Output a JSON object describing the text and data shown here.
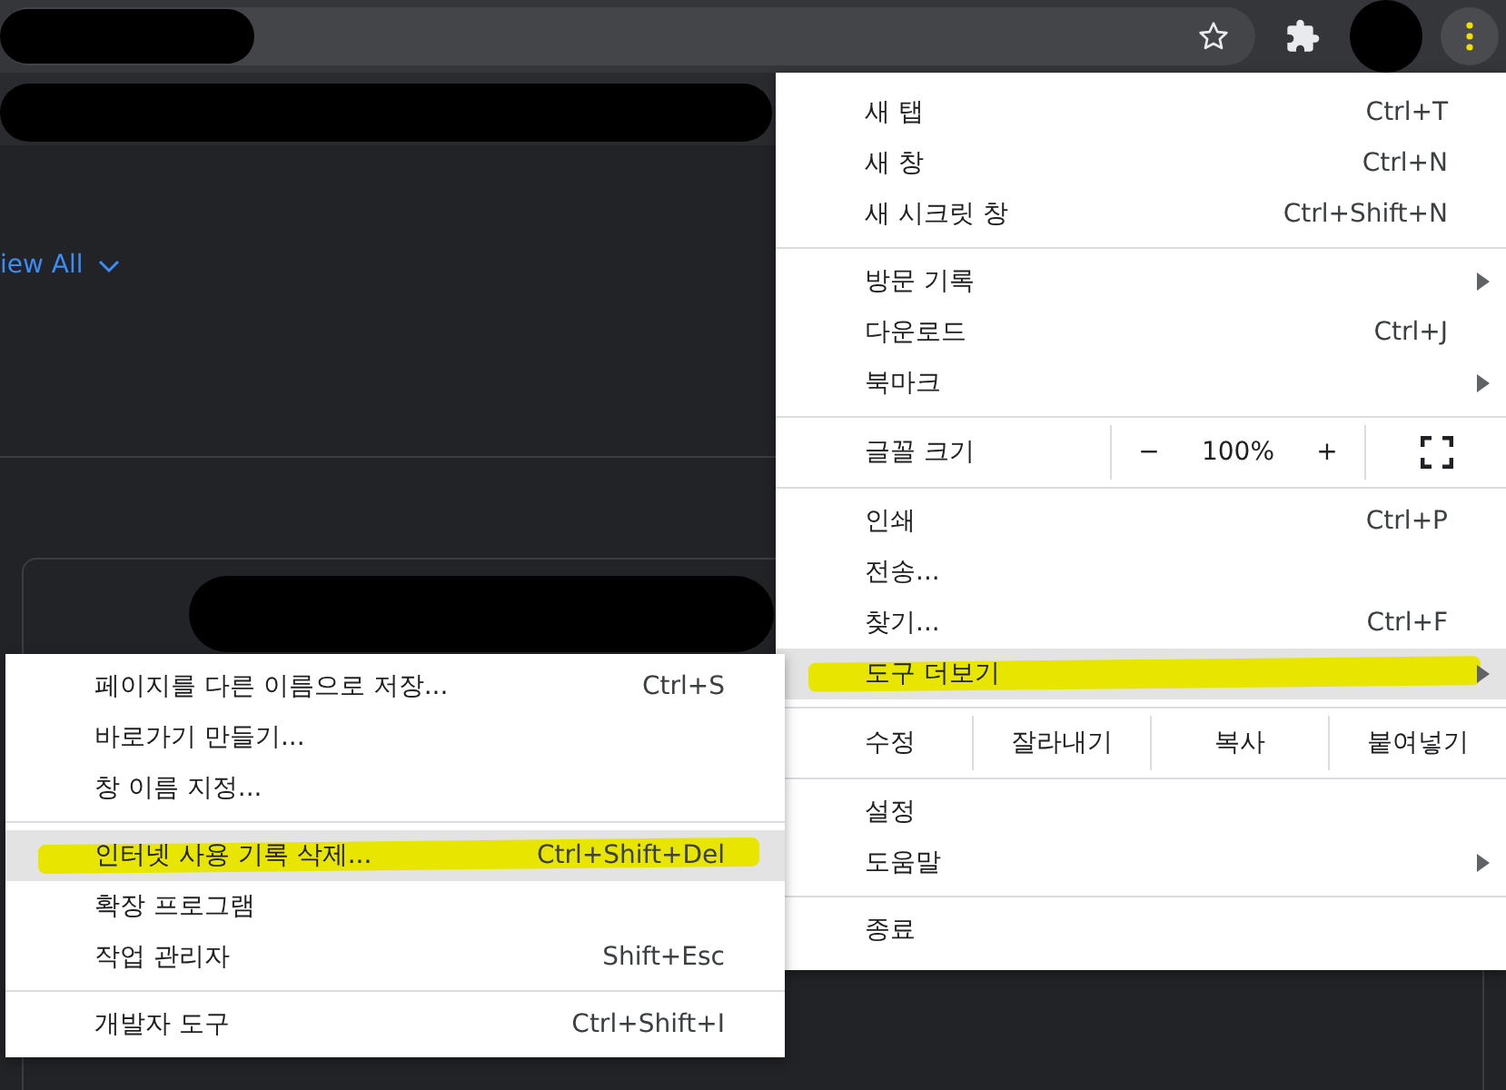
{
  "page": {
    "view_all_link": "iew All"
  },
  "main_menu": {
    "items": [
      {
        "kind": "item",
        "label": "새 탭",
        "shortcut": "Ctrl+T",
        "submenu": false,
        "highlighted": false
      },
      {
        "kind": "item",
        "label": "새 창",
        "shortcut": "Ctrl+N",
        "submenu": false,
        "highlighted": false
      },
      {
        "kind": "item",
        "label": "새 시크릿 창",
        "shortcut": "Ctrl+Shift+N",
        "submenu": false,
        "highlighted": false
      },
      {
        "kind": "separator"
      },
      {
        "kind": "item",
        "label": "방문 기록",
        "submenu": true,
        "highlighted": false
      },
      {
        "kind": "item",
        "label": "다운로드",
        "shortcut": "Ctrl+J",
        "submenu": false,
        "highlighted": false
      },
      {
        "kind": "item",
        "label": "북마크",
        "submenu": true,
        "highlighted": false
      },
      {
        "kind": "separator"
      },
      {
        "kind": "zoom",
        "label": "글꼴 크기",
        "decrease": "−",
        "value": "100%",
        "increase": "+"
      },
      {
        "kind": "separator"
      },
      {
        "kind": "item",
        "label": "인쇄",
        "shortcut": "Ctrl+P",
        "submenu": false,
        "highlighted": false
      },
      {
        "kind": "item",
        "label": "전송...",
        "submenu": false,
        "highlighted": false
      },
      {
        "kind": "item",
        "label": "찾기...",
        "shortcut": "Ctrl+F",
        "submenu": false,
        "highlighted": false
      },
      {
        "kind": "item",
        "label": "도구 더보기",
        "submenu": true,
        "highlighted": true
      },
      {
        "kind": "separator"
      },
      {
        "kind": "edit",
        "label": "수정",
        "actions": [
          "잘라내기",
          "복사",
          "붙여넣기"
        ]
      },
      {
        "kind": "separator"
      },
      {
        "kind": "item",
        "label": "설정",
        "submenu": false,
        "highlighted": false
      },
      {
        "kind": "item",
        "label": "도움말",
        "submenu": true,
        "highlighted": false
      },
      {
        "kind": "separator"
      },
      {
        "kind": "item",
        "label": "종료",
        "submenu": false,
        "highlighted": false
      }
    ]
  },
  "more_tools_menu": {
    "items": [
      {
        "kind": "item",
        "label": "페이지를 다른 이름으로 저장...",
        "shortcut": "Ctrl+S",
        "highlighted": false
      },
      {
        "kind": "item",
        "label": "바로가기 만들기...",
        "highlighted": false
      },
      {
        "kind": "item",
        "label": "창 이름 지정...",
        "highlighted": false
      },
      {
        "kind": "separator"
      },
      {
        "kind": "item",
        "label": "인터넷 사용 기록 삭제...",
        "shortcut": "Ctrl+Shift+Del",
        "highlighted": true
      },
      {
        "kind": "item",
        "label": "확장 프로그램",
        "highlighted": false
      },
      {
        "kind": "item",
        "label": "작업 관리자",
        "shortcut": "Shift+Esc",
        "highlighted": false
      },
      {
        "kind": "separator"
      },
      {
        "kind": "item",
        "label": "개발자 도구",
        "shortcut": "Ctrl+Shift+I",
        "highlighted": false
      }
    ]
  }
}
